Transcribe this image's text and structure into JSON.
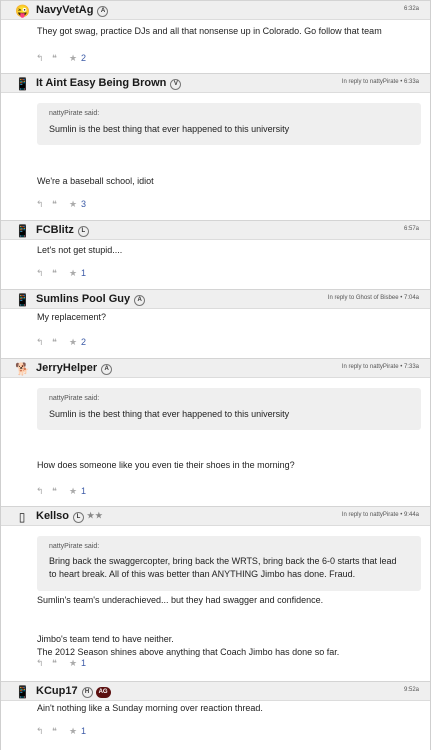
{
  "posts": [
    {
      "avatar": "😜",
      "username": "NavyVetAg",
      "badge": "A",
      "meta": "6:32a",
      "text": [
        "They got swag, practice DJs and all that nonsense up in Colorado. Go follow that team"
      ],
      "likes": "2"
    },
    {
      "avatar": "📱",
      "username": "It Aint Easy Being Brown",
      "badge": "V",
      "meta": "In reply to nattyPirate • 6:33a",
      "quote": {
        "author": "nattyPirate said:",
        "text": [
          "Sumlin is the best thing that ever happened to this university"
        ]
      },
      "text": [
        "We're a baseball school, idiot"
      ],
      "likes": "3"
    },
    {
      "avatar": "📱",
      "username": "FCBlitz",
      "badge": "L",
      "meta": "6:57a",
      "text": [
        "Let's not get stupid...."
      ],
      "likes": "1"
    },
    {
      "avatar": "📱",
      "username": "Sumlins Pool Guy",
      "badge": "A",
      "meta": "In reply to Ghost of Bisbee • 7:04a",
      "text": [
        "My replacement?"
      ],
      "likes": "2"
    },
    {
      "avatar": "🐕",
      "username": "JerryHelper",
      "badge": "A",
      "meta": "In reply to nattyPirate • 7:33a",
      "quote": {
        "author": "nattyPirate said:",
        "text": [
          "Sumlin is the best thing that ever happened to this university"
        ]
      },
      "text": [
        "How does someone like you even tie their shoes in the morning?"
      ],
      "likes": "1"
    },
    {
      "avatar": "▯",
      "username": "Kellso",
      "badge": "L",
      "stars": "★★",
      "meta": "In reply to nattyPirate • 9:44a",
      "quote": {
        "author": "nattyPirate said:",
        "text": [
          "Bring back the swaggercopter, bring back the WRTS, bring back the 6-0 starts that lead",
          "to heart break. All of this was better than ANYTHING Jimbo has done. Fraud."
        ]
      },
      "text": [
        "Sumlin's team's underachieved... but they had swagger and confidence.",
        "",
        "Jimbo's team tend to have neither.",
        "The 2012 Season shines above anything that Coach Jimbo has done so far."
      ],
      "likes": "1"
    },
    {
      "avatar": "📱",
      "username": "KCup17",
      "badge": "H",
      "badge2": "AG",
      "meta": "9:52a",
      "text": [
        "Ain't nothing like a Sunday morning over reaction thread."
      ],
      "likes": "1"
    }
  ],
  "icons": {
    "reply": "↰",
    "quote": "❝",
    "star": "★"
  }
}
